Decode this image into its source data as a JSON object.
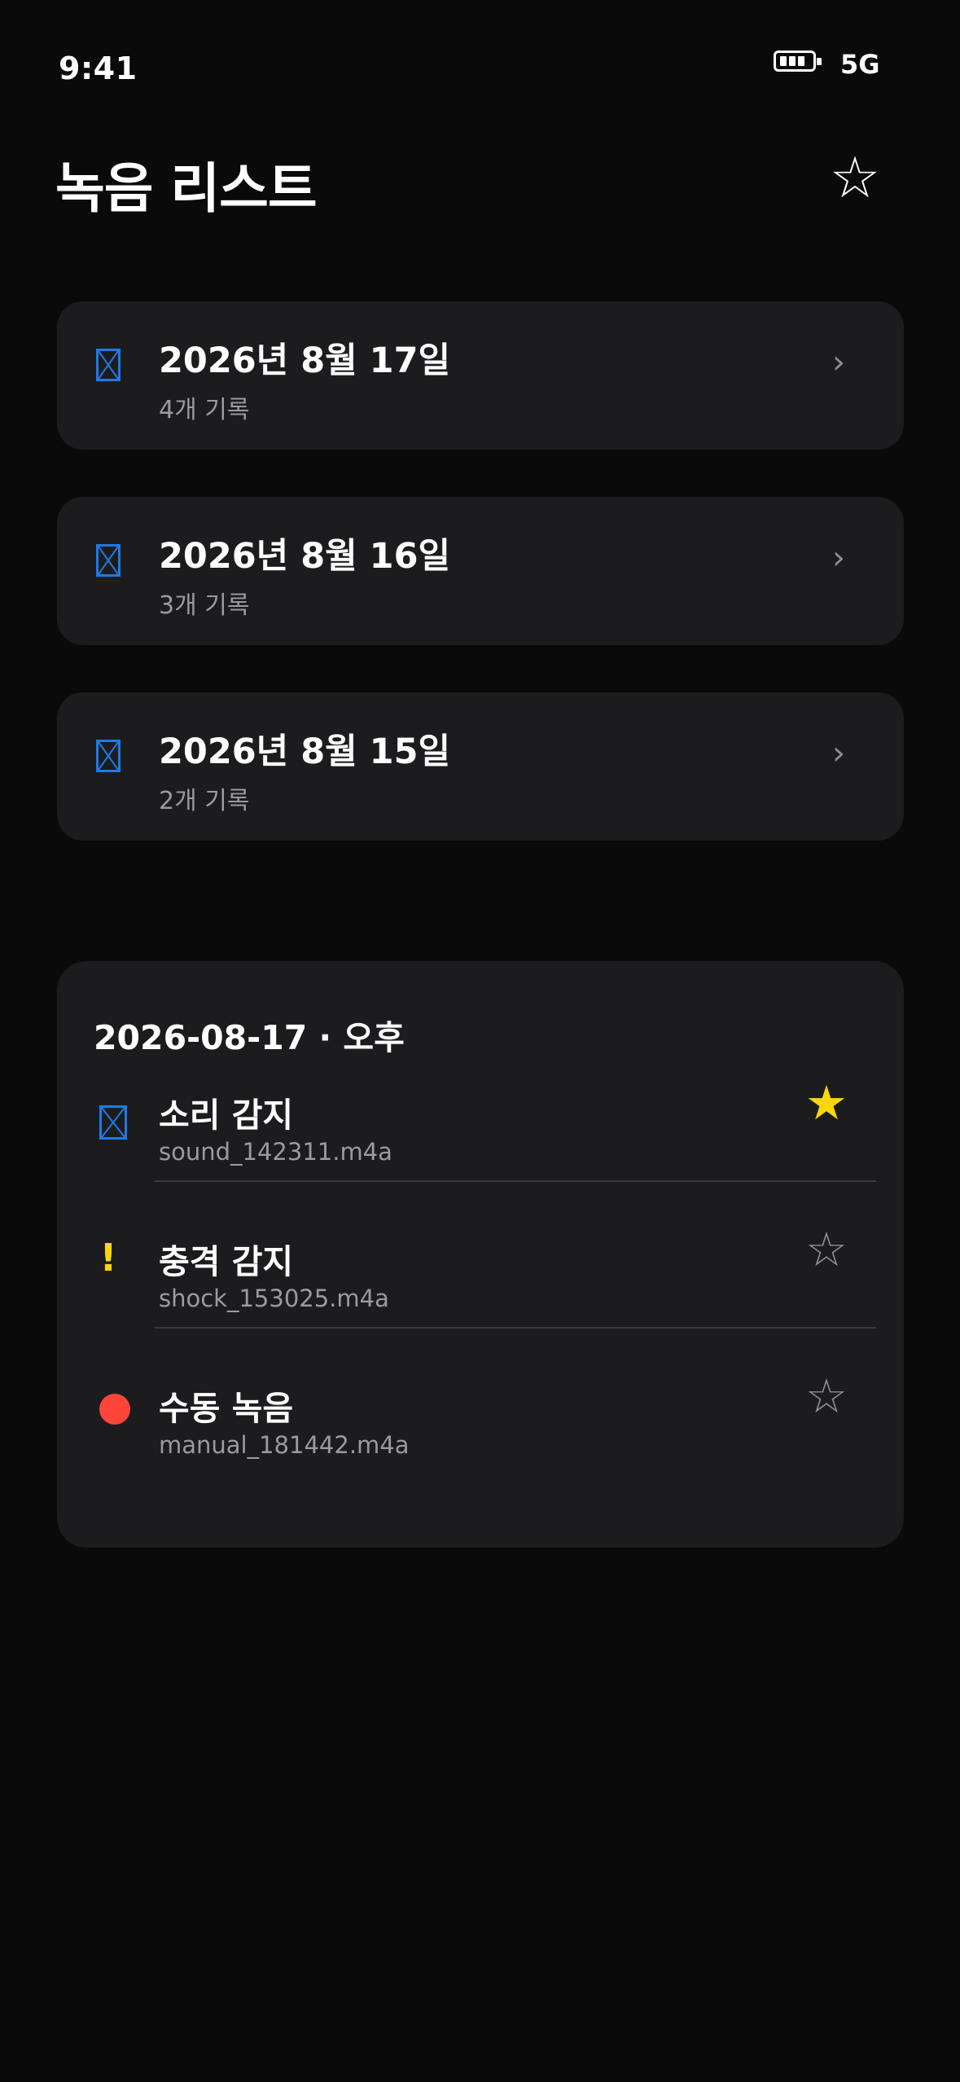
{
  "status_bar": {
    "time": "9:41",
    "network": "5G"
  },
  "header": {
    "title": "녹음 리스트",
    "favorite_icon": "star-outline-icon"
  },
  "day_groups": [
    {
      "date_label": "2026년 8월 17일",
      "count_label": "4개 기록"
    },
    {
      "date_label": "2026년 8월 16일",
      "count_label": "3개 기록"
    },
    {
      "date_label": "2026년 8월 15일",
      "count_label": "2개 기록"
    }
  ],
  "detail": {
    "header": "2026-08-17 · 오후",
    "recordings": [
      {
        "title": "소리 감지",
        "file": "sound_142311.m4a",
        "icon": "sound-detect-icon",
        "favorite": true
      },
      {
        "title": "충격 감지",
        "file": "shock_153025.m4a",
        "icon": "shock-alert-icon",
        "favorite": false
      },
      {
        "title": "수동 녹음",
        "file": "manual_181442.m4a",
        "icon": "record-dot-icon",
        "favorite": false
      }
    ]
  },
  "colors": {
    "background": "#0a0a0a",
    "card": "#1c1c1e",
    "accent_blue": "#1e7ae6",
    "favorite_yellow": "#ffd60a",
    "record_red": "#ff453a",
    "secondary_text": "#9a9a9f"
  }
}
